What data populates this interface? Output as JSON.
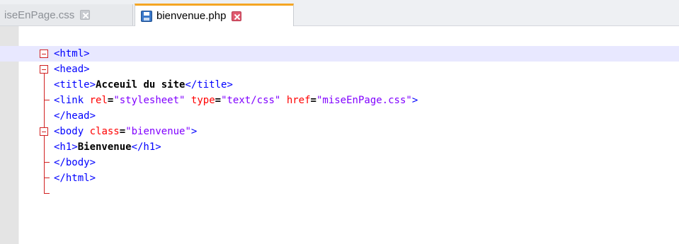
{
  "tabs": [
    {
      "label": "iseEnPage.css",
      "active": false
    },
    {
      "label": "bienvenue.php",
      "active": true
    }
  ],
  "colors": {
    "tag": "#0000ff",
    "attribute": "#ff0000",
    "string": "#8000ff",
    "text": "#000000",
    "fold_marker": "#d12020",
    "active_tab_accent": "#f5a623",
    "current_line": "#e8e8ff"
  },
  "code": {
    "line1": {
      "tag": "<html>"
    },
    "line2": {
      "tag": "<head>"
    },
    "line3": {
      "open": "<title>",
      "text": "Acceuil du site",
      "close": "</title>"
    },
    "line4": {
      "open": "<link",
      "attr1": "rel",
      "eq1": "=",
      "val1": "\"stylesheet\"",
      "attr2": "type",
      "eq2": "=",
      "val2": "\"text/css\"",
      "attr3": "href",
      "eq3": "=",
      "val3": "\"miseEnPage.css\"",
      "close": ">"
    },
    "line5": {
      "tag": "</head>"
    },
    "line6": {
      "open": "<body",
      "attr1": "class",
      "eq1": "=",
      "val1": "\"bienvenue\"",
      "close": ">"
    },
    "line7": {
      "open": "<h1>",
      "text": "Bienvenue",
      "close": "</h1>"
    },
    "line8": {
      "tag": "</body>"
    },
    "line9": {
      "tag": "</html>"
    }
  }
}
